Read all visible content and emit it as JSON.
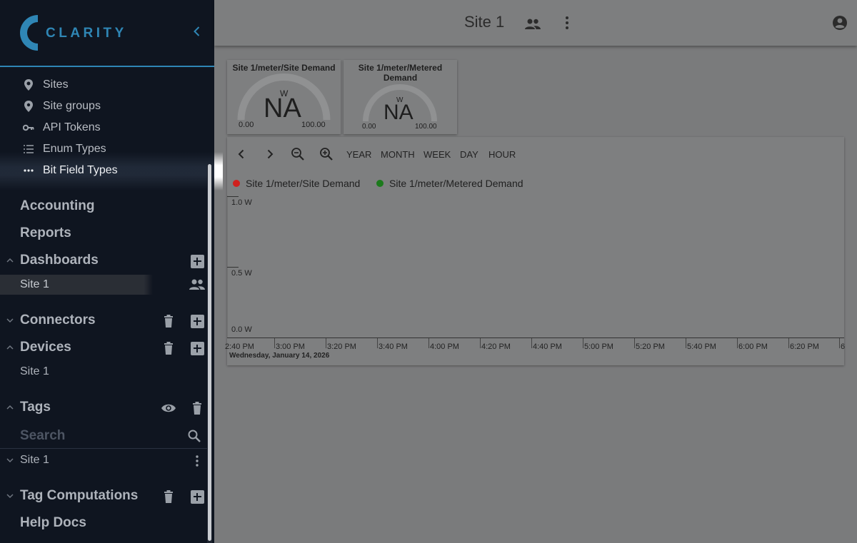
{
  "brand": {
    "name": "CLARITY"
  },
  "sidebar": {
    "items": [
      {
        "label": "Sites",
        "icon": "location-pin-icon"
      },
      {
        "label": "Site groups",
        "icon": "location-group-icon"
      },
      {
        "label": "API Tokens",
        "icon": "key-icon"
      },
      {
        "label": "Enum Types",
        "icon": "list-icon"
      },
      {
        "label": "Bit Field Types",
        "icon": "dots-icon"
      }
    ],
    "sections": {
      "accounting": "Accounting",
      "reports": "Reports",
      "dashboards": "Dashboards",
      "dashboards_items": [
        "Site 1"
      ],
      "connectors": "Connectors",
      "devices": "Devices",
      "devices_items": [
        "Site 1"
      ],
      "tags": "Tags",
      "tags_search_placeholder": "Search",
      "tags_items": [
        "Site 1"
      ],
      "tag_computations": "Tag Computations",
      "help_docs": "Help Docs"
    }
  },
  "topbar": {
    "title": "Site 1"
  },
  "gauges": [
    {
      "title": "Site 1/meter/Site Demand",
      "unit": "W",
      "value": "NA",
      "min": "0.00",
      "max": "100.00"
    },
    {
      "title": "Site 1/meter/Metered Demand",
      "unit": "W",
      "value": "NA",
      "min": "0.00",
      "max": "100.00"
    }
  ],
  "chart_toolbar": {
    "year": "YEAR",
    "month": "MONTH",
    "week": "WEEK",
    "day": "DAY",
    "hour": "HOUR"
  },
  "chart_data": {
    "type": "line",
    "series": [
      {
        "name": "Site 1/meter/Site Demand",
        "color": "#d0201d",
        "values": []
      },
      {
        "name": "Site 1/meter/Metered Demand",
        "color": "#1c7a1c",
        "values": []
      }
    ],
    "y_ticks": [
      "1.0 W",
      "0.5 W",
      "0.0 W"
    ],
    "x_ticks": [
      "2:40 PM",
      "3:00 PM",
      "3:20 PM",
      "3:40 PM",
      "4:00 PM",
      "4:20 PM",
      "4:40 PM",
      "5:00 PM",
      "5:20 PM",
      "5:40 PM",
      "6:00 PM",
      "6:20 PM",
      "6"
    ],
    "ylim": [
      0,
      1
    ],
    "date_label": "Wednesday, January 14, 2026"
  },
  "colors": {
    "accent": "#2f86b5",
    "sidebar_bg": "#0f1520",
    "overlay_bg": "#7a7b7c"
  }
}
